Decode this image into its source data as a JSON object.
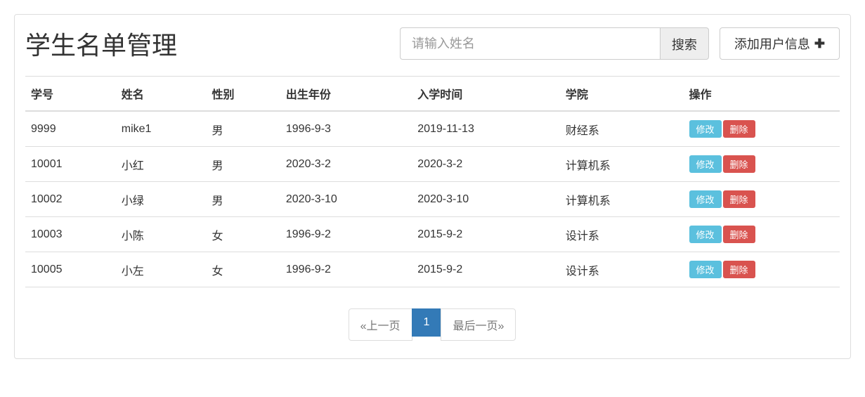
{
  "page": {
    "title": "学生名单管理"
  },
  "search": {
    "placeholder": "请输入姓名",
    "button_label": "搜索"
  },
  "add_button": {
    "label": "添加用户信息",
    "icon": "plus-icon"
  },
  "table": {
    "headers": {
      "id": "学号",
      "name": "姓名",
      "gender": "性别",
      "birth": "出生年份",
      "admit": "入学时间",
      "dept": "学院",
      "ops": "操作"
    },
    "rows": [
      {
        "id": "9999",
        "name": "mike1",
        "gender": "男",
        "birth": "1996-9-3",
        "admit": "2019-11-13",
        "dept": "财经系"
      },
      {
        "id": "10001",
        "name": "小红",
        "gender": "男",
        "birth": "2020-3-2",
        "admit": "2020-3-2",
        "dept": "计算机系"
      },
      {
        "id": "10002",
        "name": "小绿",
        "gender": "男",
        "birth": "2020-3-10",
        "admit": "2020-3-10",
        "dept": "计算机系"
      },
      {
        "id": "10003",
        "name": "小陈",
        "gender": "女",
        "birth": "1996-9-2",
        "admit": "2015-9-2",
        "dept": "设计系"
      },
      {
        "id": "10005",
        "name": "小左",
        "gender": "女",
        "birth": "1996-9-2",
        "admit": "2015-9-2",
        "dept": "设计系"
      }
    ],
    "row_actions": {
      "edit": "修改",
      "delete": "删除"
    }
  },
  "pagination": {
    "prev": "«上一页",
    "current": "1",
    "last": "最后一页»"
  }
}
